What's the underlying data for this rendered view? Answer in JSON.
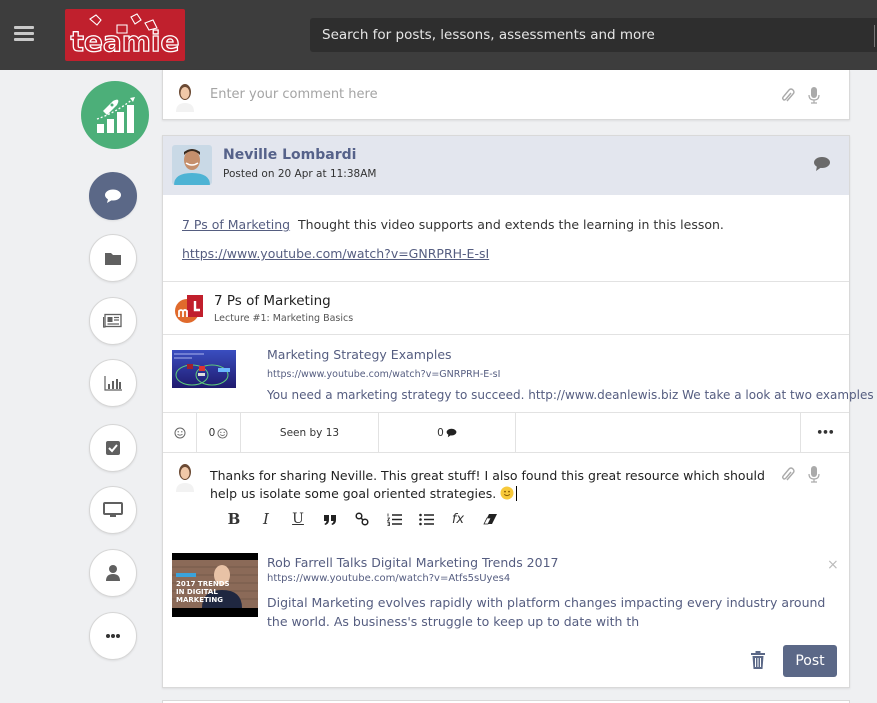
{
  "topbar": {
    "menu_icon": "hamburger-icon",
    "logo_text": "teamie",
    "search_placeholder": "Search for posts, lessons, assessments and more"
  },
  "rail": {
    "logo_icon": "rocket-growth-icon",
    "items": [
      {
        "name": "posts",
        "icon": "speech-bubble-icon",
        "active": true
      },
      {
        "name": "files",
        "icon": "folder-icon",
        "active": false
      },
      {
        "name": "news",
        "icon": "newspaper-icon",
        "active": false
      },
      {
        "name": "reports",
        "icon": "bar-chart-icon",
        "active": false
      },
      {
        "name": "tasks",
        "icon": "checkbox-icon",
        "active": false
      },
      {
        "name": "screen",
        "icon": "monitor-icon",
        "active": false
      },
      {
        "name": "profile",
        "icon": "user-icon",
        "active": false
      },
      {
        "name": "more",
        "icon": "more-icon",
        "active": false
      }
    ]
  },
  "top_comment": {
    "placeholder": "Enter your comment here",
    "attach_icon": "paperclip-icon",
    "mic_icon": "microphone-icon"
  },
  "post": {
    "author": "Neville Lombardi",
    "posted": "Posted on 20 Apr at 11:38AM",
    "type_icon": "speech-bubble-icon",
    "body_link": "7 Ps of Marketing",
    "body_text": "Thought this video supports and extends the learning in this lesson.",
    "body_url": "https://www.youtube.com/watch?v=GNRPRH-E-sI",
    "lesson": {
      "title": "7 Ps of Marketing",
      "subtitle": "Lecture #1: Marketing Basics"
    },
    "preview": {
      "title": "Marketing Strategy Examples",
      "url": "https://www.youtube.com/watch?v=GNRPRH-E-sI",
      "description": "You need a marketing strategy to succeed. http://www.deanlewis.biz We take a look at two examples of"
    },
    "actions": {
      "reactions_count": "0",
      "seen_by": "Seen by 13",
      "comments_count": "0",
      "more": "•••"
    }
  },
  "reply": {
    "text": "Thanks for sharing Neville. This great stuff! I also found this great resource which should help us isolate some goal oriented strategies.",
    "emoji": "smiley-emoji",
    "toolbar": [
      {
        "name": "bold",
        "label": "B"
      },
      {
        "name": "italic",
        "label": "I"
      },
      {
        "name": "underline",
        "label": "U"
      },
      {
        "name": "quote",
        "label": "❞"
      },
      {
        "name": "link",
        "label": "🔗"
      },
      {
        "name": "ordered-list",
        "label": "≡"
      },
      {
        "name": "bullet-list",
        "label": "☰"
      },
      {
        "name": "formula",
        "label": "fx"
      },
      {
        "name": "eraser",
        "label": "⌫"
      }
    ],
    "embed": {
      "title": "Rob Farrell Talks Digital Marketing Trends 2017",
      "url": "https://www.youtube.com/watch?v=Atfs5sUyes4",
      "description": "Digital Marketing evolves rapidly with platform changes impacting every industry around the world. As business's struggle to keep up to date with th",
      "thumb_text": "2017 TRENDS IN DIGITAL MARKETING",
      "close": "×"
    },
    "post_label": "Post"
  },
  "colors": {
    "topbar": "#3d3d3d",
    "brand_red": "#c0202d",
    "rail_green": "#4caf79",
    "accent": "#5b6887",
    "link": "#555d80"
  }
}
